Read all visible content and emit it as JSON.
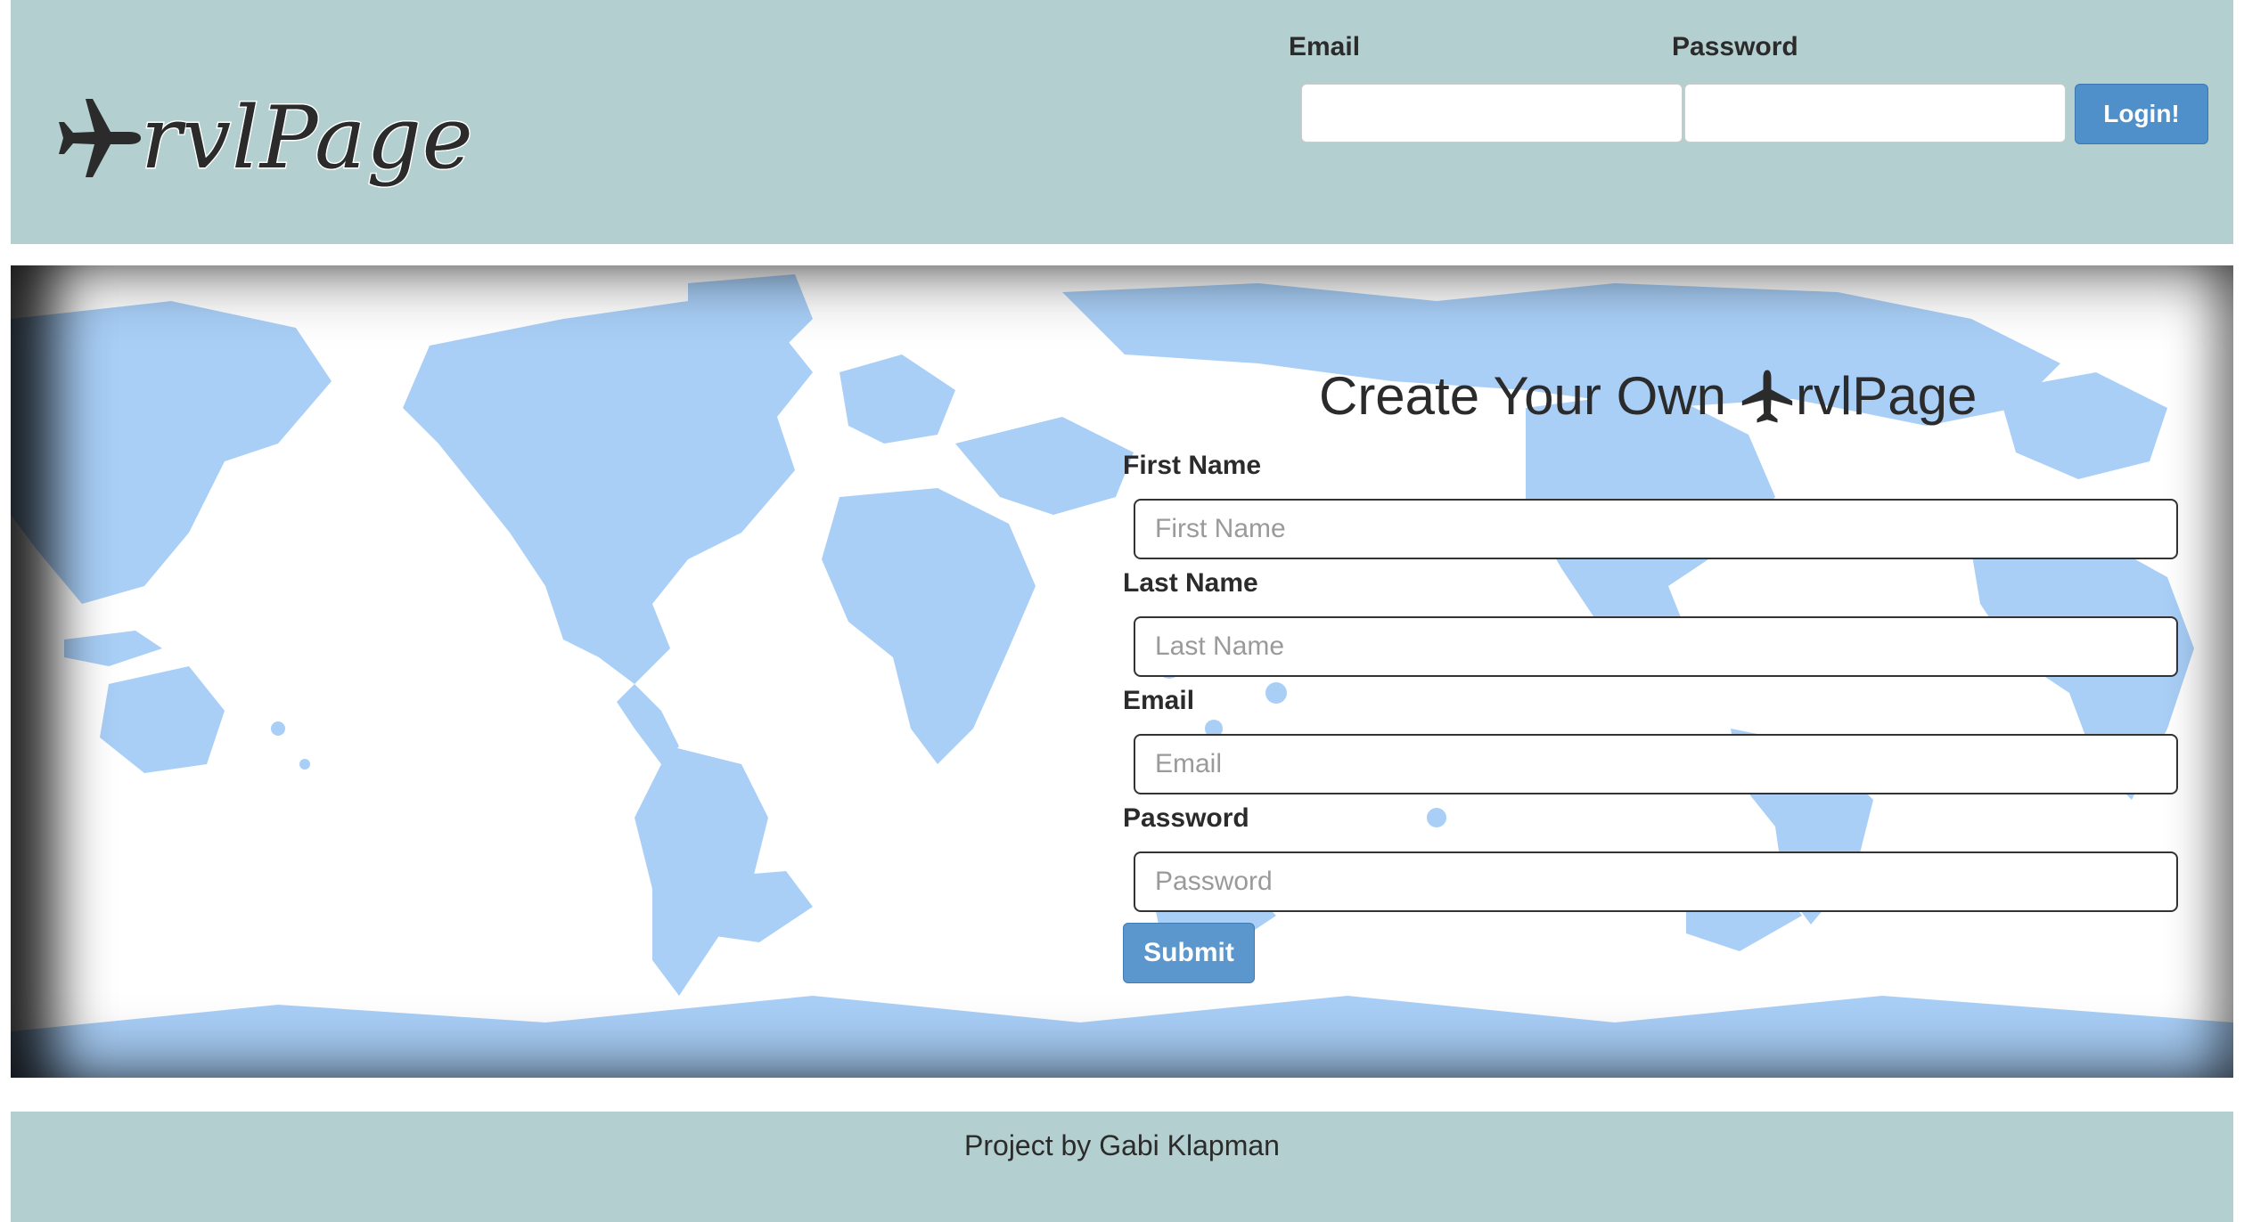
{
  "header": {
    "logo_text": "rvlPage",
    "email_label": "Email",
    "password_label": "Password",
    "login_button": "Login!",
    "email_value": "",
    "password_value": ""
  },
  "signup": {
    "title_prefix": "Create Your Own",
    "title_suffix": "rvlPage",
    "fields": [
      {
        "label": "First Name",
        "placeholder": "First Name"
      },
      {
        "label": "Last Name",
        "placeholder": "Last Name"
      },
      {
        "label": "Email",
        "placeholder": "Email"
      },
      {
        "label": "Password",
        "placeholder": "Password"
      }
    ],
    "submit_button": "Submit"
  },
  "footer": {
    "credit": "Project by Gabi Klapman"
  },
  "colors": {
    "header_bg": "#b3cfcf",
    "primary_button": "#4f8fca",
    "map_land": "#a9cff7",
    "map_ocean": "#ffffff"
  },
  "icons": {
    "logo": "airplane-icon",
    "title": "airplane-icon"
  }
}
